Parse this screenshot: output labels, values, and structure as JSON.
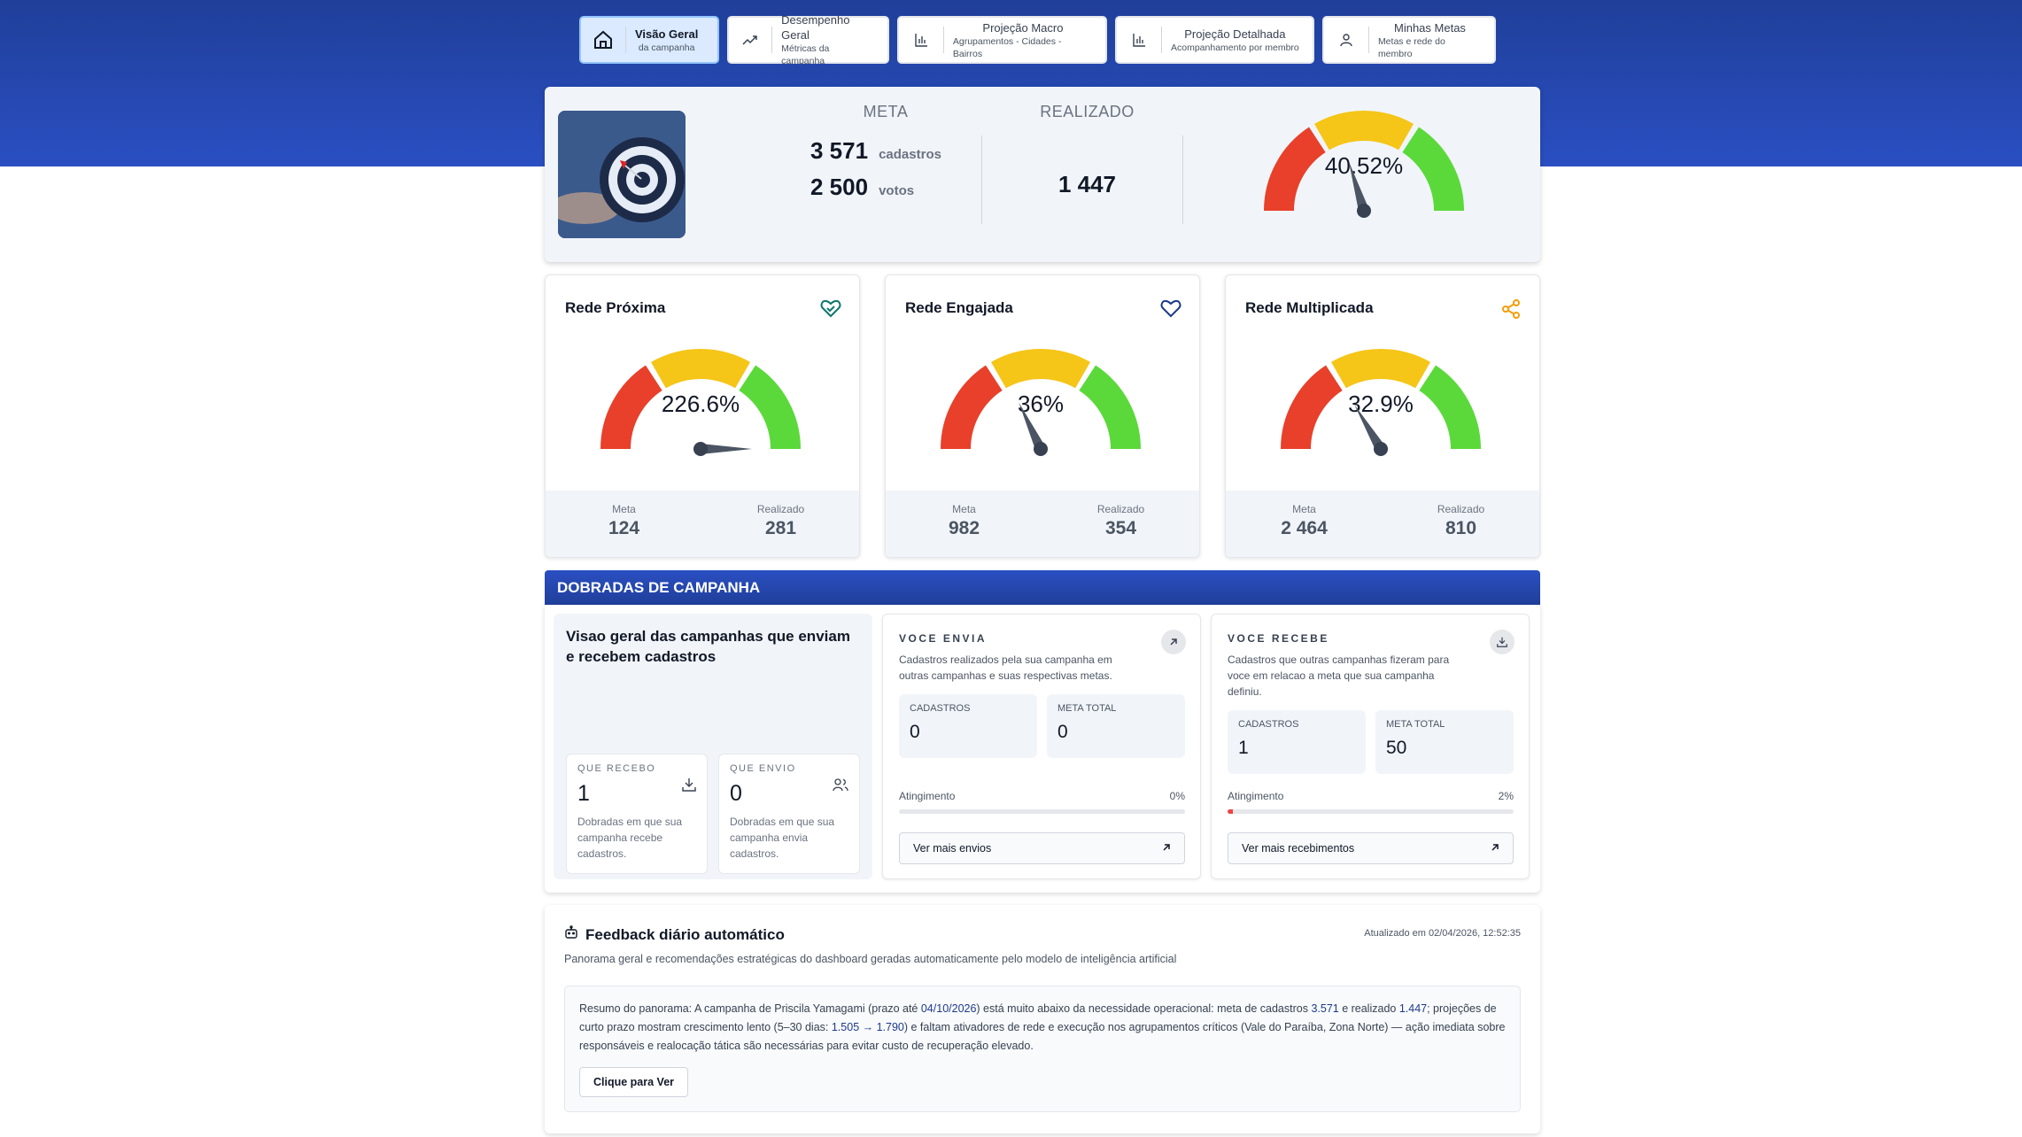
{
  "nav": [
    {
      "title": "Visão Geral",
      "sub": "da campanha",
      "icon": "home-icon",
      "active": true
    },
    {
      "title": "Desempenho Geral",
      "sub": "Métricas da campanha",
      "icon": "trend-icon",
      "active": false
    },
    {
      "title": "Projeção Macro",
      "sub": "Agrupamentos - Cidades - Bairros",
      "icon": "bar-chart-icon",
      "active": false
    },
    {
      "title": "Projeção Detalhada",
      "sub": "Acompanhamento por membro",
      "icon": "bar-chart-icon",
      "active": false
    },
    {
      "title": "Minhas Metas",
      "sub": "Metas e rede do membro",
      "icon": "user-icon",
      "active": false
    }
  ],
  "summary": {
    "meta_label": "META",
    "realizado_label": "REALIZADO",
    "cadastros_value": "3 571",
    "cadastros_unit": "cadastros",
    "votos_value": "2 500",
    "votos_unit": "votos",
    "realizado_value": "1 447",
    "gauge_pct": "40.52%",
    "gauge_fraction": 0.4052
  },
  "redes": [
    {
      "title": "Rede Próxima",
      "icon": "handshake-heart-icon",
      "icon_color": "#0f766e",
      "pct": "226.6%",
      "fraction": 1.0,
      "meta_label": "Meta",
      "meta": "124",
      "real_label": "Realizado",
      "real": "281"
    },
    {
      "title": "Rede Engajada",
      "icon": "heart-icon",
      "icon_color": "#1e3a8a",
      "pct": "36%",
      "fraction": 0.36,
      "meta_label": "Meta",
      "meta": "982",
      "real_label": "Realizado",
      "real": "354"
    },
    {
      "title": "Rede Multiplicada",
      "icon": "share-icon",
      "icon_color": "#f59e0b",
      "pct": "32.9%",
      "fraction": 0.329,
      "meta_label": "Meta",
      "meta": "2 464",
      "real_label": "Realizado",
      "real": "810"
    }
  ],
  "dobradas": {
    "header": "DOBRADAS DE CAMPANHA",
    "overview_title": "Visao geral das campanhas que enviam e recebem cadastros",
    "recebo": {
      "label": "QUE RECEBO",
      "value": "1",
      "desc": "Dobradas em que sua campanha recebe cadastros."
    },
    "envio": {
      "label": "QUE ENVIO",
      "value": "0",
      "desc": "Dobradas em que sua campanha envia cadastros."
    },
    "envia": {
      "label": "VOCE ENVIA",
      "desc": "Cadastros realizados pela sua campanha em outras campanhas e suas respectivas metas.",
      "cad_label": "CADASTROS",
      "cad_value": "0",
      "meta_label": "META TOTAL",
      "meta_value": "0",
      "ating_label": "Atingimento",
      "ating_value": "0%",
      "ating_fraction": 0.0,
      "button": "Ver mais envios"
    },
    "recebe": {
      "label": "VOCE RECEBE",
      "desc": "Cadastros que outras campanhas fizeram para voce em relacao a meta que sua campanha definiu.",
      "cad_label": "CADASTROS",
      "cad_value": "1",
      "meta_label": "META TOTAL",
      "meta_value": "50",
      "ating_label": "Atingimento",
      "ating_value": "2%",
      "ating_fraction": 0.02,
      "button": "Ver mais recebimentos"
    }
  },
  "feedback": {
    "title": "Feedback diário automático",
    "updated": "Atualizado em 02/04/2026, 12:52:35",
    "subtitle": "Panorama geral e recomendações estratégicas do dashboard geradas automaticamente pelo modelo de inteligência artificial",
    "text_a": "Resumo do panorama: A campanha de Priscila Yamagami (prazo até ",
    "date": "04/10/2026",
    "text_b": ") está muito abaixo da necessidade operacional: meta de cadastros ",
    "meta": "3.571",
    "text_c": " e realizado ",
    "real": "1.447",
    "text_d": "; projeções de curto prazo mostram crescimento lento (5–30 dias: ",
    "proj": "1.505 → 1.790",
    "text_e": ") e faltam ativadores de rede e execução nos agrupamentos críticos (Vale do Paraíba, Zona Norte) — ação imediata sobre responsáveis e realocação tática são necessárias para evitar custo de recuperação elevado.",
    "button": "Clique para Ver"
  },
  "colors": {
    "red": "#e8402a",
    "yellow": "#f5c518",
    "green": "#5bd93a",
    "needle": "#4b5563",
    "brand": "#2a4fc2"
  }
}
